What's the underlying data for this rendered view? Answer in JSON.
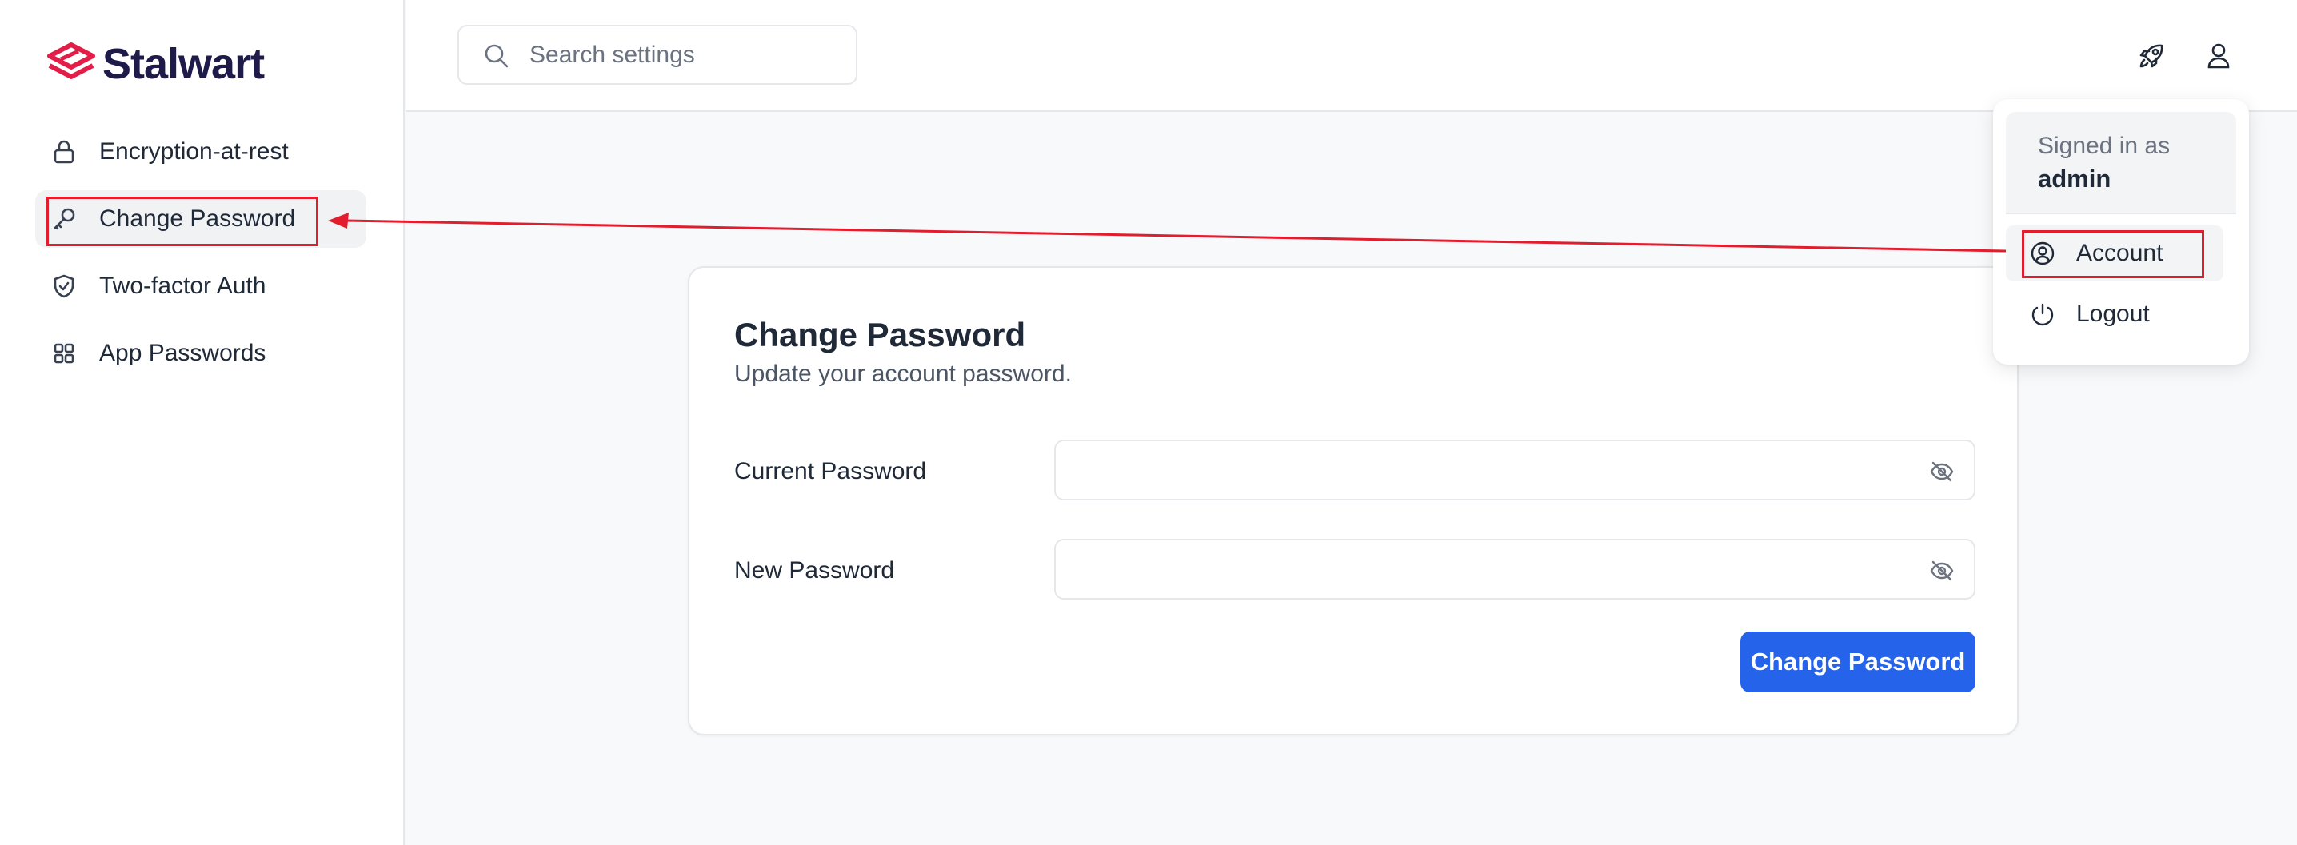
{
  "app": {
    "brand": "Stalwart",
    "brand_color": "#e11d48",
    "accent_color": "#2563eb"
  },
  "sidebar": {
    "items": [
      {
        "label": "Encryption-at-rest",
        "icon": "lock-icon"
      },
      {
        "label": "Change Password",
        "icon": "key-icon",
        "active": true
      },
      {
        "label": "Two-factor Auth",
        "icon": "shield-check-icon"
      },
      {
        "label": "App Passwords",
        "icon": "grid-icon"
      }
    ]
  },
  "header": {
    "search_placeholder": "Search settings",
    "icons": [
      "rocket-icon",
      "user-icon"
    ]
  },
  "card": {
    "title": "Change Password",
    "subtitle": "Update your account password.",
    "fields": [
      {
        "label": "Current Password",
        "value": ""
      },
      {
        "label": "New Password",
        "value": ""
      }
    ],
    "submit_label": "Change Password"
  },
  "user_menu": {
    "signed_in_label": "Signed in as",
    "username": "admin",
    "items": [
      {
        "label": "Account",
        "icon": "user-circle-icon"
      },
      {
        "label": "Logout",
        "icon": "power-icon"
      }
    ]
  },
  "annotation": {
    "color": "#e11d2e"
  }
}
